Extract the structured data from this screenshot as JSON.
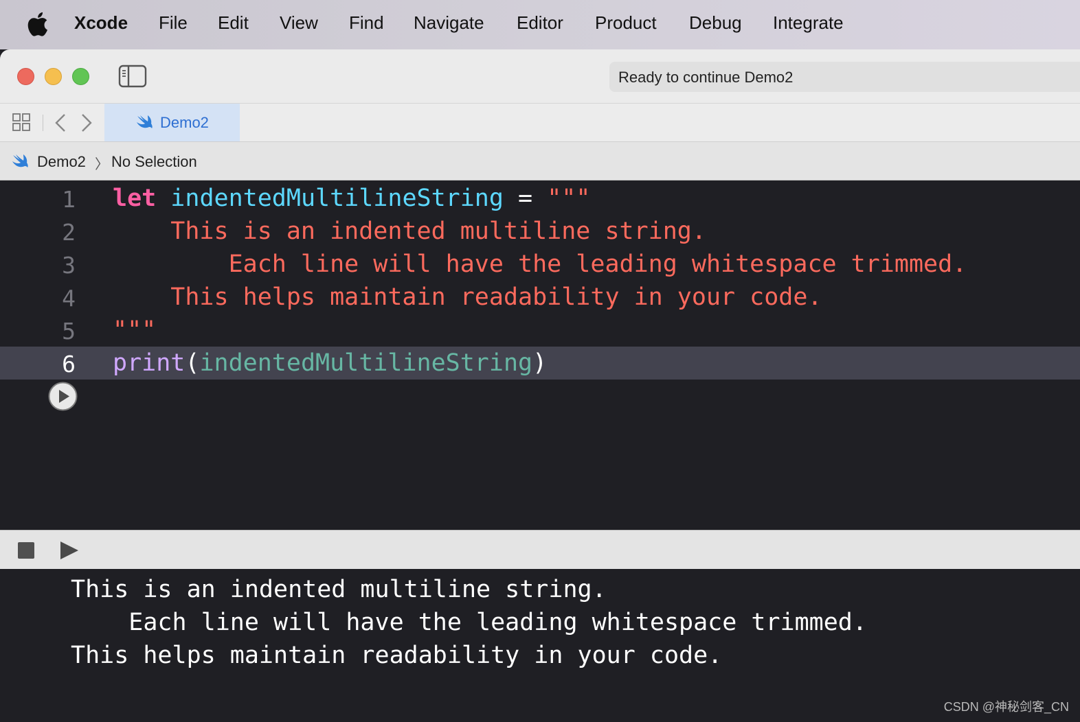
{
  "menubar": {
    "app_name": "Xcode",
    "items": [
      "File",
      "Edit",
      "View",
      "Find",
      "Navigate",
      "Editor",
      "Product",
      "Debug",
      "Integrate"
    ]
  },
  "window": {
    "status": "Ready to continue Demo2",
    "tab": {
      "label": "Demo2",
      "icon": "swift-icon"
    },
    "breadcrumb": {
      "file": "Demo2",
      "separator": "〉",
      "selection": "No Selection"
    }
  },
  "editor": {
    "current_line": 6,
    "lines": [
      {
        "num": "1"
      },
      {
        "num": "2",
        "text": "    This is an indented multiline string."
      },
      {
        "num": "3",
        "text": "        Each line will have the leading whitespace trimmed."
      },
      {
        "num": "4",
        "text": "    This helps maintain readability in your code."
      },
      {
        "num": "5",
        "text": "\"\"\""
      },
      {
        "num": "6"
      }
    ],
    "line1": {
      "kw": "let",
      "ident": "indentedMultilineString",
      "op": "=",
      "str": "\"\"\""
    },
    "line6": {
      "func": "print",
      "open": "(",
      "arg": "indentedMultilineString",
      "close": ")"
    }
  },
  "console": {
    "lines": [
      "This is an indented multiline string.",
      "    Each line will have the leading whitespace trimmed.",
      "This helps maintain readability in your code."
    ]
  },
  "watermark": "CSDN @神秘剑客_CN",
  "colors": {
    "keyword": "#fc5fa3",
    "identifier": "#5dd8ff",
    "string": "#fc6a5d",
    "function": "#d0a8ff",
    "editor_bg": "#1f1f24",
    "tab_accent": "#2e6fd2"
  }
}
